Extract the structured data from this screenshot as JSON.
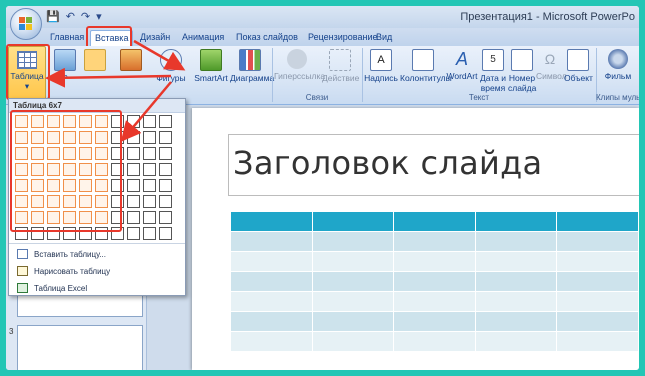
{
  "title_bar": {
    "title": "Презентация1 - Microsoft PowerPo",
    "qat_save": "💾",
    "qat_undo": "↶",
    "qat_redo": "↷",
    "qat_customize": "▾"
  },
  "tabs": [
    {
      "label": "Главная"
    },
    {
      "label": "Вставка"
    },
    {
      "label": "Дизайн"
    },
    {
      "label": "Анимация"
    },
    {
      "label": "Показ слайдов"
    },
    {
      "label": "Рецензирование"
    },
    {
      "label": "Вид"
    }
  ],
  "ribbon": {
    "table_button": "Таблица",
    "picture_button": "Р",
    "clipart_button": "",
    "photoalbum_button": "",
    "shapes_button": "Фигуры",
    "smartart_button": "SmartArt",
    "chart_button": "Диаграмма",
    "hyperlink_button": "Гиперссылка",
    "action_button": "Действие",
    "links_group": "Связи",
    "textbox_button": "Надпись",
    "header_footer_button": "Колонтитулы",
    "wordart_button": "WordArt",
    "datetime_button_1": "Дата и",
    "datetime_button_2": "время",
    "slidenum_button_1": "Номер",
    "slidenum_button_2": "слайда",
    "symbol_button": "Символ",
    "object_button": "Объект",
    "text_group": "Текст",
    "movie_button": "Фильм",
    "media_group": "Клипы муль"
  },
  "dropdown": {
    "header": "Таблица 6x7",
    "rows": 8,
    "cols": 10,
    "selected_rows": 7,
    "selected_cols": 6,
    "items": [
      {
        "label": "Вставить таблицу..."
      },
      {
        "label": "Нарисовать таблицу"
      },
      {
        "label": "Таблица Excel"
      }
    ]
  },
  "thumbnails": {
    "slide3_number": "3"
  },
  "slide": {
    "title": "Заголовок слайда"
  },
  "colors": {
    "highlight": "#e8382b",
    "table_header": "#1fa6c9",
    "grid_selection": "#f0904a"
  }
}
